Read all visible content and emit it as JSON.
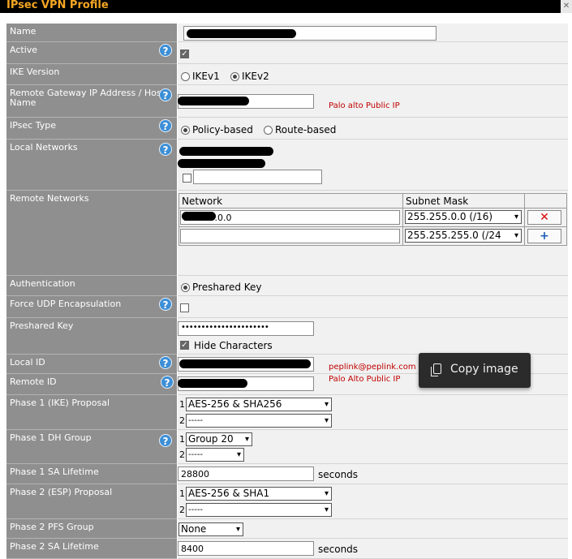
{
  "window": {
    "title": "IPsec VPN Profile",
    "close_glyph": "✕"
  },
  "fields": {
    "name": {
      "label": "Name"
    },
    "active": {
      "label": "Active",
      "checked": true
    },
    "ike_version": {
      "label": "IKE Version",
      "options": [
        "IKEv1",
        "IKEv2"
      ],
      "selected": "IKEv2"
    },
    "remote_gateway": {
      "label": "Remote Gateway IP Address / Host Name",
      "annotation": "Palo alto Public IP"
    },
    "ipsec_type": {
      "label": "IPsec Type",
      "options": [
        "Policy-based",
        "Route-based"
      ],
      "selected": "Policy-based"
    },
    "local_networks": {
      "label": "Local Networks"
    },
    "remote_networks": {
      "label": "Remote Networks",
      "columns": [
        "Network",
        "Subnet Mask"
      ],
      "rows": [
        {
          "network": "172.16.0.0",
          "mask": "255.255.0.0 (/16)",
          "action": "✕"
        },
        {
          "network": "",
          "mask": "255.255.255.0 (/24",
          "action": "+"
        }
      ]
    },
    "authentication": {
      "label": "Authentication",
      "option": "Preshared Key"
    },
    "force_udp": {
      "label": "Force UDP Encapsulation",
      "checked": false
    },
    "preshared_key": {
      "label": "Preshared Key",
      "value": "••••••••••••••••••••••",
      "hide_label": "Hide Characters",
      "hide_checked": true
    },
    "local_id": {
      "label": "Local ID",
      "annotation": "peplink@peplink.com"
    },
    "remote_id": {
      "label": "Remote ID",
      "annotation": "Palo Alto Public IP"
    },
    "phase1_proposal": {
      "label": "Phase 1 (IKE) Proposal",
      "idx1": "1",
      "idx2": "2",
      "value1": "AES-256 & SHA256",
      "value2": "-----"
    },
    "phase1_dh": {
      "label": "Phase 1 DH Group",
      "idx1": "1",
      "idx2": "2",
      "value1": "Group 20",
      "value2": "-----"
    },
    "phase1_lifetime": {
      "label": "Phase 1 SA Lifetime",
      "value": "28800",
      "unit": "seconds"
    },
    "phase2_proposal": {
      "label": "Phase 2 (ESP) Proposal",
      "idx1": "1",
      "idx2": "2",
      "value1": "AES-256 & SHA1",
      "value2": "-----"
    },
    "phase2_pfs": {
      "label": "Phase 2 PFS Group",
      "value": "None"
    },
    "phase2_lifetime": {
      "label": "Phase 2 SA Lifetime",
      "value": "8400",
      "unit": "seconds"
    }
  },
  "help_glyph": "?",
  "caret_glyph": "▾",
  "tooltip": {
    "label": "Copy image",
    "icon": "copy-icon"
  },
  "colors": {
    "title": "#f5a623",
    "label_bg": "#8f8f8f",
    "help": "#3d8fd6",
    "annotation": "#c00000",
    "remove": "#d40000",
    "add": "#1f5fb5"
  }
}
